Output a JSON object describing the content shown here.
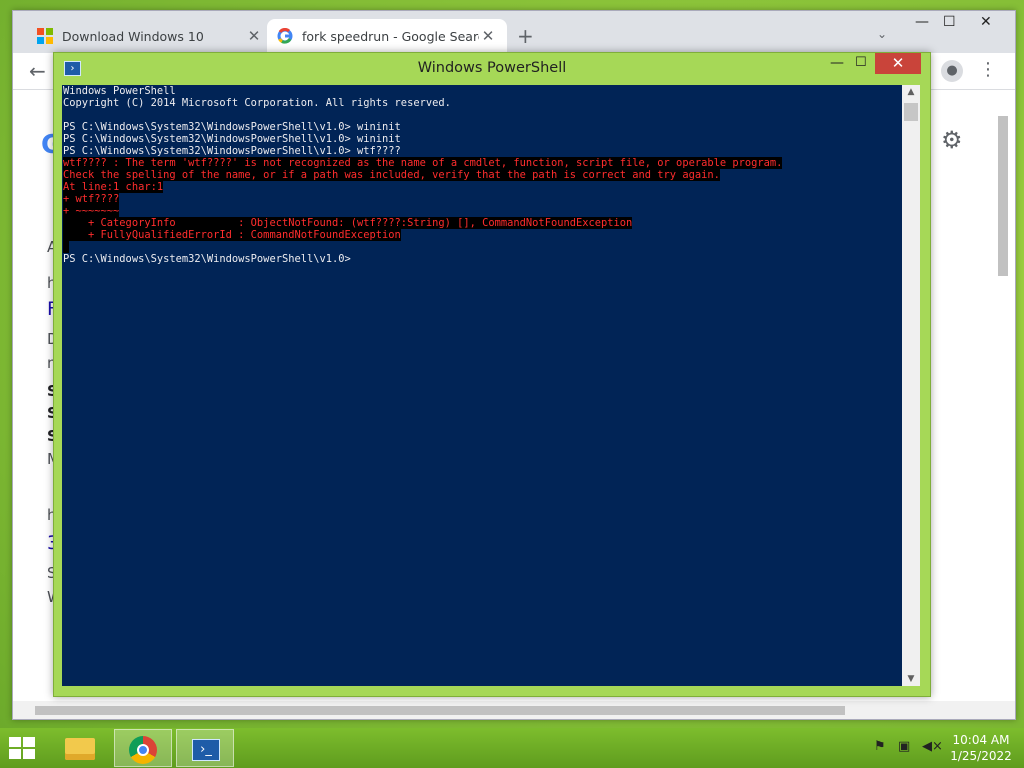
{
  "browser": {
    "tabs": [
      {
        "label": "Download Windows 10",
        "active": false
      },
      {
        "label": "fork speedrun - Google Search",
        "active": true
      }
    ],
    "new_tab": "+",
    "tab_search": "⌄",
    "window_controls": {
      "minimize": "—",
      "maximize": "☐",
      "close": "✕"
    },
    "back": "←",
    "profile": "●",
    "menu": "⋮",
    "page": {
      "settings_icon": "⚙",
      "logo_peek": "G",
      "peek_lines": [
        "A",
        "h",
        "F",
        "D",
        "m",
        "S",
        "S",
        "S",
        "M",
        "h",
        "3",
        "S",
        "W"
      ]
    }
  },
  "powershell": {
    "title": "Windows PowerShell",
    "controls": {
      "minimize": "—",
      "maximize": "☐",
      "close": "✕"
    },
    "lines": [
      {
        "text": "Windows PowerShell",
        "error": false
      },
      {
        "text": "Copyright (C) 2014 Microsoft Corporation. All rights reserved.",
        "error": false
      },
      {
        "text": "",
        "error": false
      },
      {
        "text": "PS C:\\Windows\\System32\\WindowsPowerShell\\v1.0> wininit",
        "error": false
      },
      {
        "text": "PS C:\\Windows\\System32\\WindowsPowerShell\\v1.0> wininit",
        "error": false
      },
      {
        "text": "PS C:\\Windows\\System32\\WindowsPowerShell\\v1.0> wtf????",
        "error": false
      },
      {
        "text": "wtf???? : The term 'wtf????' is not recognized as the name of a cmdlet, function, script file, or operable program.",
        "error": true
      },
      {
        "text": "Check the spelling of the name, or if a path was included, verify that the path is correct and try again.",
        "error": true
      },
      {
        "text": "At line:1 char:1",
        "error": true
      },
      {
        "text": "+ wtf????",
        "error": true
      },
      {
        "text": "+ ~~~~~~~",
        "error": true
      },
      {
        "text": "    + CategoryInfo          : ObjectNotFound: (wtf????:String) [], CommandNotFoundException",
        "error": true
      },
      {
        "text": "    + FullyQualifiedErrorId : CommandNotFoundException",
        "error": true
      },
      {
        "text": " ",
        "error": true
      },
      {
        "text": "PS C:\\Windows\\System32\\WindowsPowerShell\\v1.0>",
        "error": false
      }
    ],
    "scroll_up": "▲",
    "scroll_down": "▼"
  },
  "taskbar": {
    "powershell_icon": "›_",
    "tray_icons": [
      "flag-icon",
      "network-icon",
      "speaker-muted-icon"
    ],
    "time": "10:04 AM",
    "date": "1/25/2022"
  },
  "colors": {
    "console_bg": "#012456",
    "error_fg": "#ff2d2d",
    "window_frame": "#a6d857",
    "close_red": "#c9443a"
  }
}
